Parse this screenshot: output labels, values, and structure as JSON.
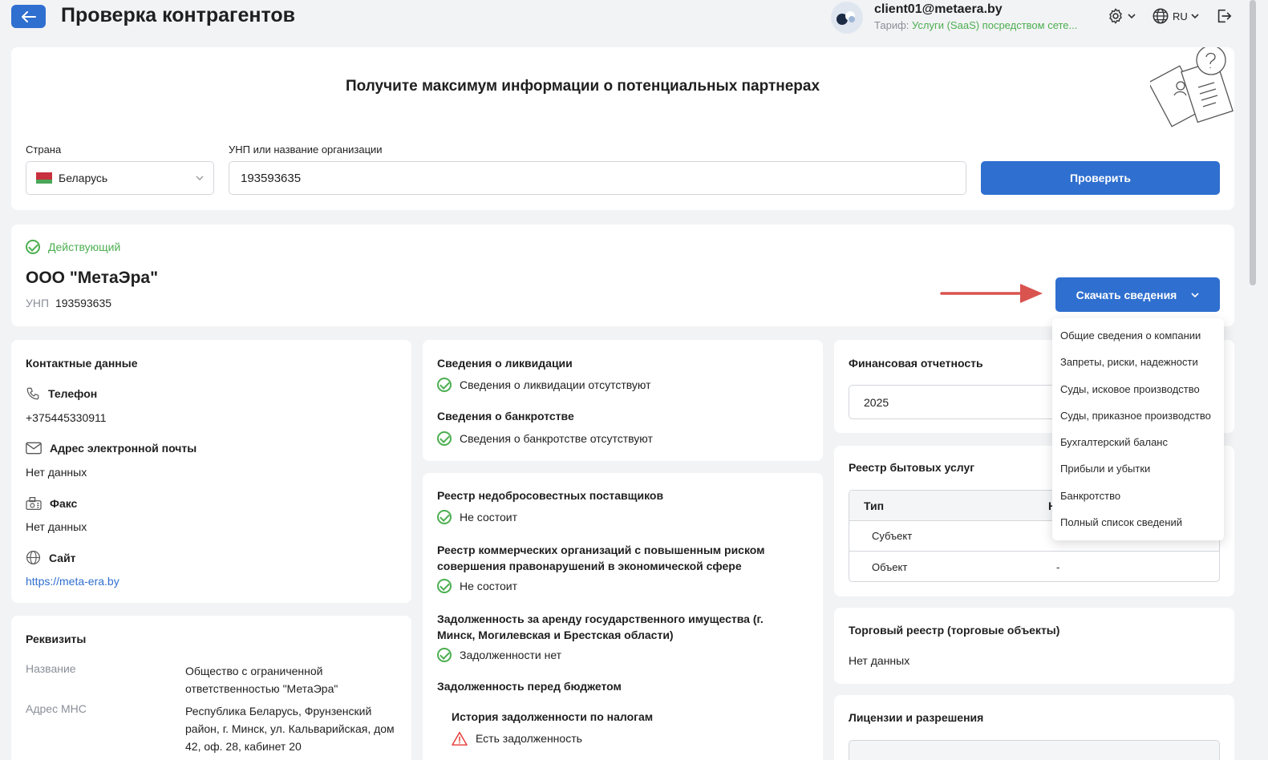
{
  "header": {
    "title": "Проверка контрагентов",
    "user_email": "client01@metaera.by",
    "tariff_label": "Тариф:",
    "tariff_value": "Услуги (SaaS) посредством сете...",
    "lang": "RU"
  },
  "search": {
    "heading": "Получите максимум информации о потенциальных партнерах",
    "country_label": "Страна",
    "country_value": "Беларусь",
    "query_label": "УНП или название организации",
    "query_value": "193593635",
    "submit_label": "Проверить"
  },
  "company": {
    "status": "Действующий",
    "name": "ООО \"МетаЭра\"",
    "unp_label": "УНП",
    "unp_value": "193593635",
    "download_label": "Скачать сведения"
  },
  "download_menu": [
    "Общие сведения о компании",
    "Запреты, риски, надежности",
    "Суды, исковое производство",
    "Суды, приказное производство",
    "Бухгалтерский баланс",
    "Прибыли и убытки",
    "Банкротство",
    "Полный список сведений"
  ],
  "contacts": {
    "title": "Контактные данные",
    "phone_label": "Телефон",
    "phone_value": "+375445330911",
    "email_label": "Адрес электронной почты",
    "email_value": "Нет данных",
    "fax_label": "Факс",
    "fax_value": "Нет данных",
    "site_label": "Сайт",
    "site_value": "https://meta-era.by"
  },
  "requisites": {
    "title": "Реквизиты",
    "name_label": "Название",
    "name_value": "Общество с ограниченной ответственностью \"МетаЭра\"",
    "address_label": "Адрес МНС",
    "address_value": "Республика Беларусь, Фрунзенский район, г. Минск, ул. Кальварийская, дом 42, оф. 28, кабинет 20"
  },
  "liquidation": {
    "title": "Сведения о ликвидации",
    "value": "Сведения о ликвидации отсутствуют",
    "bankruptcy_title": "Сведения о банкротстве",
    "bankruptcy_value": "Сведения о банкротстве отсутствуют"
  },
  "registers": {
    "unfair_title": "Реестр недобросовестных поставщиков",
    "unfair_value": "Не состоит",
    "risk_title": "Реестр коммерческих организаций с повышенным риском совершения правонарушений в экономической сфере",
    "risk_value": "Не состоит",
    "rent_title": "Задолженность за аренду государственного имущества (г. Минск, Могилевская и Брестская области)",
    "rent_value": "Задолженности нет",
    "budget_title": "Задолженность перед бюджетом",
    "tax_history_title": "История задолженности по налогам",
    "tax_history_value": "Есть задолженность"
  },
  "finance": {
    "title": "Финансовая отчетность",
    "year": "2025"
  },
  "household": {
    "title": "Реестр бытовых услуг",
    "col_type": "Тип",
    "col_second": "Н",
    "rows": [
      {
        "type": "Субъект",
        "value": ""
      },
      {
        "type": "Объект",
        "value": "-"
      }
    ]
  },
  "trade": {
    "title": "Торговый реестр (торговые объекты)",
    "value": "Нет данных"
  },
  "licenses": {
    "title": "Лицензии и разрешения"
  },
  "colors": {
    "primary": "#2f6fcf",
    "success": "#4caf50",
    "arrow": "#d9534f",
    "warning": "#e53935"
  }
}
